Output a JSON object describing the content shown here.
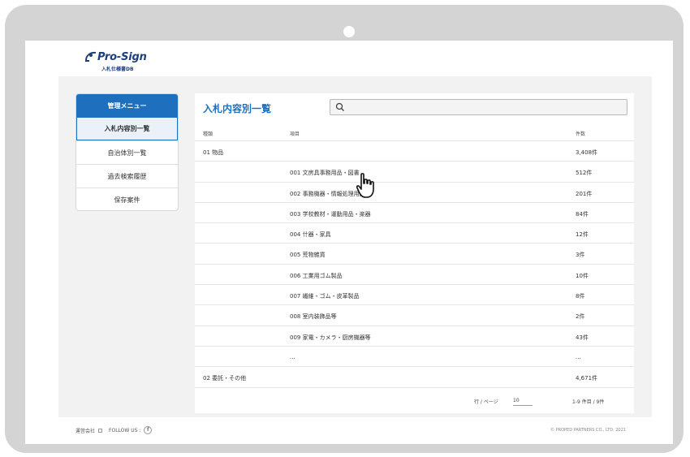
{
  "brand": {
    "name": "Pro-Sign",
    "subtitle": "入札仕様書DB",
    "color": "#1e3f7a"
  },
  "sidebar": {
    "header": "管理メニュー",
    "items": [
      {
        "label": "入札内容別一覧",
        "active": true
      },
      {
        "label": "自治体別一覧"
      },
      {
        "label": "過去検索履歴"
      },
      {
        "label": "保存案件"
      }
    ]
  },
  "main": {
    "title": "入札内容別一覧",
    "search": {
      "placeholder": "",
      "value": ""
    },
    "columns": {
      "type": "種類",
      "item": "項目",
      "count": "件数"
    },
    "rows": [
      {
        "type": "01 物品",
        "item": "",
        "count": "3,408件"
      },
      {
        "type": "",
        "item": "001 文房具事務用品・図書",
        "count": "512件"
      },
      {
        "type": "",
        "item": "002 事務機器・情報処理用品",
        "count": "201件"
      },
      {
        "type": "",
        "item": "003 学校教材・運動用品・楽器",
        "count": "84件"
      },
      {
        "type": "",
        "item": "004 什器・家具",
        "count": "12件"
      },
      {
        "type": "",
        "item": "005 荒物雑貨",
        "count": "3件"
      },
      {
        "type": "",
        "item": "006 工業用ゴム製品",
        "count": "10件"
      },
      {
        "type": "",
        "item": "007 繊維・ゴム・皮革製品",
        "count": "8件"
      },
      {
        "type": "",
        "item": "008 室内装飾品等",
        "count": "2件"
      },
      {
        "type": "",
        "item": "009 家電・カメラ・厨房機器等",
        "count": "43件"
      },
      {
        "type": "",
        "item": "...",
        "count": "..."
      },
      {
        "type": "02 委託・その他",
        "item": "",
        "count": "4,671件"
      }
    ],
    "pagination": {
      "rows_label": "行 / ページ",
      "rows_value": "10",
      "range": "1-9 件目 / 9件"
    }
  },
  "footer": {
    "company": "運営会社",
    "follow": "FOLLOW US :",
    "facebook_icon": "facebook-icon",
    "copyright": "© PROPED PARTNERS CO., LTD. 2021"
  },
  "colors": {
    "accent": "#1f6fbf",
    "device": "#d4d4d4",
    "background": "#f2f2f2"
  }
}
